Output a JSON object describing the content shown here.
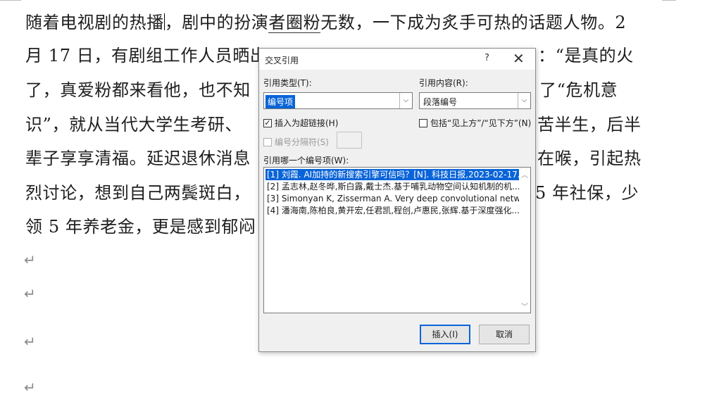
{
  "document": {
    "lines": [
      "随着电视剧的热播",
      "，剧中的扮演",
      "者圈粉",
      "无数，一下成为炙手可热的话题人物。2",
      "月 17 日，有剧组工作人员晒出",
      "：“是真的火",
      "了，真爱粉都来看他，也不知",
      "了“危机意",
      "识”，就从当代大学生考研、",
      "苦半生，后半",
      "辈子享享清福。延迟退休消息",
      "在喉，引起热",
      "烈讨论，想到自己两鬓斑白，",
      "5 年社保，少",
      "领 5 年养老金，更是感到郁闷"
    ],
    "paragraph_mark": "↵"
  },
  "dialog": {
    "title": "交叉引用",
    "help_icon": "?",
    "close_icon": "✕",
    "ref_type_label": "引用类型(T):",
    "ref_type_value": "编号项",
    "ref_content_label": "引用内容(R):",
    "ref_content_value": "段落编号",
    "insert_hyperlink_label": "插入为超链接(H)",
    "insert_hyperlink_checked": true,
    "include_above_below_label": "包括“见上方”/“见下方”(N)",
    "include_above_below_checked": false,
    "separator_label": "编号分隔符(S)",
    "which_item_label": "引用哪一个编号项(W):",
    "items": [
      "[1] 刘霞. AI加持的新搜索引擎可信吗？[N]. 科技日报,2023-02-17...",
      "[2] 孟志林,赵冬晔,斯白露,戴士杰.基于哺乳动物空间认知机制的机...",
      "[3] Simonyan K, Zisserman A. Very deep convolutional netw...",
      "[4] 潘海南,陈柏良,黄开宏,任君凯,程创,卢惠民,张辉.基于深度强化..."
    ],
    "insert_button": "插入(I)",
    "cancel_button": "取消"
  },
  "colors": {
    "accent": "#0a64d8",
    "dialog_bg": "#f0f0f0"
  }
}
